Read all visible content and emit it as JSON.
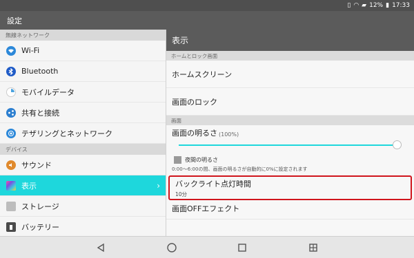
{
  "status_bar": {
    "battery": "12%",
    "time": "17:33"
  },
  "app_bar": {
    "title": "設定"
  },
  "left": {
    "sections": [
      {
        "header": "無線ネットワーク",
        "items": [
          {
            "label": "Wi-Fi",
            "icon": "wifi-icon",
            "color": "#2c88d9"
          },
          {
            "label": "Bluetooth",
            "icon": "bluetooth-icon",
            "color": "#1f5bc7"
          },
          {
            "label": "モバイルデータ",
            "icon": "mobile-data-icon",
            "color": "#4aa3df"
          },
          {
            "label": "共有と接続",
            "icon": "share-icon",
            "color": "#2c7fd0"
          },
          {
            "label": "テザリングとネットワーク",
            "icon": "tethering-icon",
            "color": "#2c88d9"
          }
        ]
      },
      {
        "header": "デバイス",
        "items": [
          {
            "label": "サウンド",
            "icon": "sound-icon",
            "color": "#e08a2d"
          },
          {
            "label": "表示",
            "icon": "display-icon",
            "color": "#c84fd8"
          },
          {
            "label": "ストレージ",
            "icon": "storage-icon",
            "color": "#8a8a8a"
          },
          {
            "label": "バッテリー",
            "icon": "battery-icon",
            "color": "#4a4a4a"
          }
        ]
      }
    ]
  },
  "right": {
    "title": "表示",
    "section1_header": "ホームとロック画面",
    "home_screen": "ホームスクリーン",
    "lock_screen": "画面のロック",
    "section2_header": "画面",
    "brightness_label": "画面の明るさ",
    "brightness_value": "(100%)",
    "brightness_level": 1.0,
    "night_label": "夜間の明るさ",
    "night_desc": "0:00～6:00の間、画面の明るさが自動的に0%に設定されます",
    "backlight_title": "バックライト点灯時間",
    "backlight_value": "10分",
    "screen_off_effect": "画面OFFエフェクト"
  },
  "accent_color": "#1ed7dc",
  "highlight_color": "#d0141c"
}
